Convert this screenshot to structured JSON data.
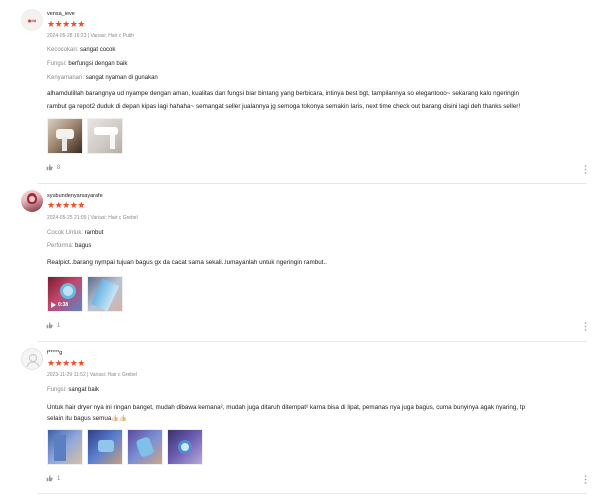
{
  "reviews": [
    {
      "username": "vensa_ieve",
      "avatar_text": "◉dd",
      "stars": "★★★★★",
      "meta": "2024-05-28 16:23 | Variasi: Hair c Putih",
      "attributes": [
        {
          "label": "Kecocokan:",
          "value": "sangat cocok"
        },
        {
          "label": "Fungsi:",
          "value": "berfungsi dengan baik"
        },
        {
          "label": "Kenyamanan:",
          "value": "sangat nyaman di gunakan"
        }
      ],
      "text_lines": [
        "alhamdulillah barangnya ud nyampe dengan aman, kualitas dan fungsi biar bintang yang berbicara, intinya best bgt, tampilannya so elegantooo~ sekarang kalo ngeringin",
        "rambut ga repot2 duduk di depan kipas lagi hahaha~ semangat seller jualannya jg semoga tokonya semakin laris, next time check out barang disini lagi deh thanks seller!"
      ],
      "likes": "8"
    },
    {
      "username": "syubundenyarsayarafe",
      "stars": "★★★★★",
      "meta": "2024-05-25 21:09 | Variasi: Hair c Grebel",
      "attributes": [
        {
          "label": "Cocok Untuk:",
          "value": "rambut"
        },
        {
          "label": "Performa:",
          "value": "bagus"
        }
      ],
      "text_lines": [
        "Realpict..barang nympai tujuan bagus gx da cacat sama sekali..lumayanlah untuk ngeringin rambut.."
      ],
      "video_duration": "0:38",
      "likes": "1"
    },
    {
      "username": "f*****g",
      "stars": "★★★★★",
      "meta": "2023-11-29 11:52 | Variasi: Hair c Grebel",
      "attributes": [
        {
          "label": "Fungsi:",
          "value": "sangat baik"
        }
      ],
      "text_lines": [
        "Untuk hair dryer nya ini ringan banget, mudah dibawa kemana², mudah juga ditaruh ditempat² karna bisa di lipat, pemanas nya juga bagus, cuma bunyinya agak nyaring, tp",
        "selain itu bagus semua👍🏻👍🏻"
      ],
      "likes": "1"
    }
  ],
  "icons": {
    "like": "thumbs-up-icon",
    "more": "more-vertical-icon"
  },
  "colors": {
    "star": "#ee4d2d",
    "muted": "#8a8a8a"
  }
}
